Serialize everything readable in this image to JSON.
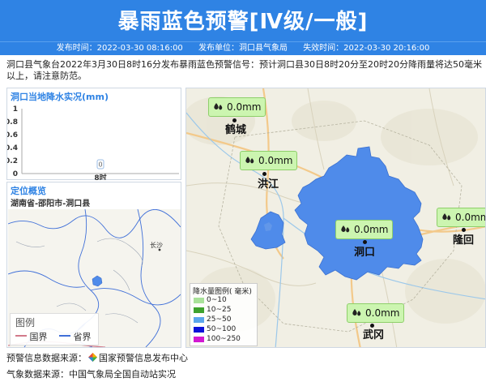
{
  "header": {
    "title": "暴雨蓝色预警[Ⅳ级/一般]",
    "publish_time": "发布时间：2022-03-30 08:16:00",
    "publisher": "发布单位：洞口县气象局",
    "expire_time": "失效时间：2022-03-30 20:16:00"
  },
  "description": "洞口县气象台2022年3月30日8时16分发布暴雨蓝色预警信号：预计洞口县30日8时20分至20时20分降雨量将达50毫米以上，请注意防范。",
  "rain_panel": {
    "title": "洞口当地降水实况(mm)",
    "chart_data": {
      "type": "bar",
      "categories": [
        "8时"
      ],
      "values": [
        0
      ],
      "data_labels": [
        "0"
      ],
      "yticks": [
        "1",
        "0.8",
        "0.6",
        "0.4",
        "0.2",
        "0"
      ],
      "ylim": [
        0,
        1
      ]
    }
  },
  "location_panel": {
    "title": "定位概览",
    "region": "湖南省-邵阳市-洞口县",
    "map_city_label": "长沙",
    "legend": {
      "title": "图例",
      "items": [
        {
          "label": "国界",
          "color": "#d27a8a"
        },
        {
          "label": "省界",
          "color": "#3f6fd8"
        }
      ]
    }
  },
  "map": {
    "stations": [
      {
        "value": "0.0mm",
        "city": "鹤城"
      },
      {
        "value": "0.0mm",
        "city": "洪江"
      },
      {
        "value": "0.0mm",
        "city": "洞口"
      },
      {
        "value": "0.0mm",
        "city": "隆回"
      },
      {
        "value": "0.0mm",
        "city": "武冈"
      }
    ],
    "legend": {
      "title": "降水量图例( 毫米)",
      "items": [
        {
          "label": "0~10",
          "color": "#a9e29a"
        },
        {
          "label": "10~25",
          "color": "#3ea22e"
        },
        {
          "label": "25~50",
          "color": "#5ba6ec"
        },
        {
          "label": "50~100",
          "color": "#0d12d9"
        },
        {
          "label": "100~250",
          "color": "#d219d2"
        }
      ]
    },
    "warning_area_color": "#4f8bea"
  },
  "footer": {
    "warning_source_prefix": "预警信息数据来源：",
    "warning_source_name": "国家预警信息发布中心",
    "weather_source": "气象数据来源：中国气象局全国自动站实况"
  }
}
